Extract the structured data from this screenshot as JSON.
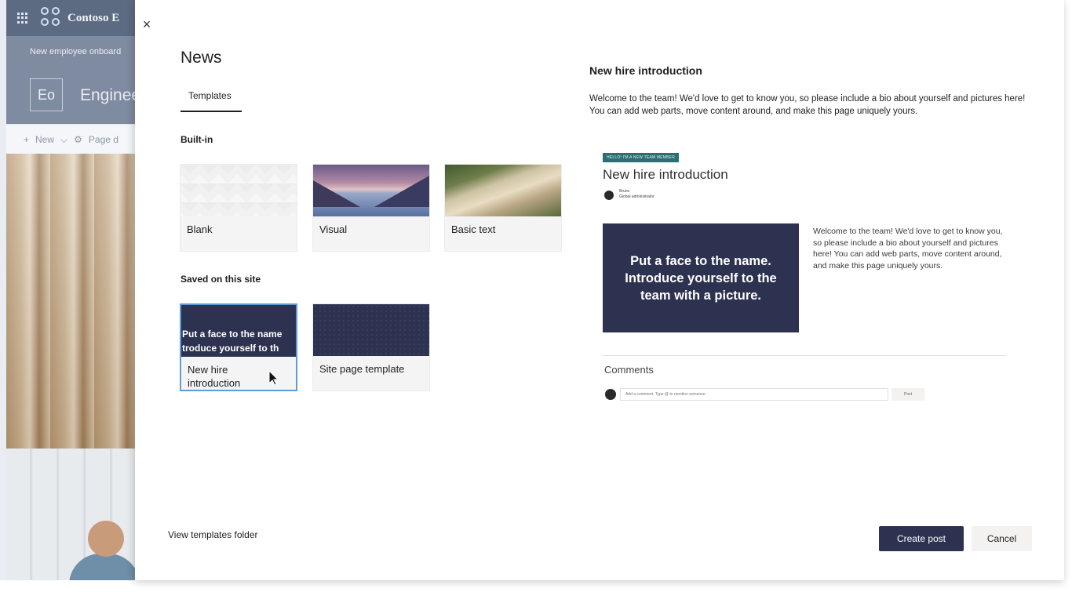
{
  "background_page": {
    "brand_name": "Contoso E",
    "hub_nav_text": "New employee onboard",
    "site_logo_initials": "Eo",
    "site_title": "Engineer",
    "command_new": "New",
    "command_page": "Page d"
  },
  "panel": {
    "title": "News",
    "close_label": "×",
    "tabs": [
      {
        "label": "Templates",
        "selected": true
      }
    ],
    "sections": {
      "built_in": {
        "heading": "Built-in",
        "templates": [
          {
            "label": "Blank"
          },
          {
            "label": "Visual"
          },
          {
            "label": "Basic text"
          }
        ]
      },
      "saved": {
        "heading": "Saved on this site",
        "templates": [
          {
            "label": "New hire introduction",
            "thumb_text_1": "Put a face to the name",
            "thumb_text_2": "troduce yourself to th",
            "selected": true
          },
          {
            "label": "Site page template"
          }
        ]
      }
    },
    "view_templates_folder": "View templates folder"
  },
  "preview": {
    "title": "New hire introduction",
    "description": "Welcome to the team! We'd love to get to know you, so please include a bio about yourself and pictures here! You can add web parts, move content around, and make this page uniquely yours.",
    "mini_page": {
      "badge": "HELLO! I'M A NEW TEAM MEMBER",
      "title": "New hire introduction",
      "author_name": "Bruno",
      "author_role": "Global administrator",
      "hero_text": "Put a face to the name. Introduce yourself to the team with a picture.",
      "body_text": "Welcome to the team! We'd love to get to know you, so please include a bio about yourself and pictures here! You can add web parts, move content around, and make this page uniquely yours.",
      "comments_heading": "Comments",
      "comment_placeholder": "Add a comment. Type @ to mention someone",
      "post_label": "Post"
    }
  },
  "footer": {
    "create_label": "Create post",
    "cancel_label": "Cancel"
  },
  "colors": {
    "accent_dark": "#2d3250",
    "badge_teal": "#2b6f74",
    "selection_blue": "#5f9bd9"
  }
}
